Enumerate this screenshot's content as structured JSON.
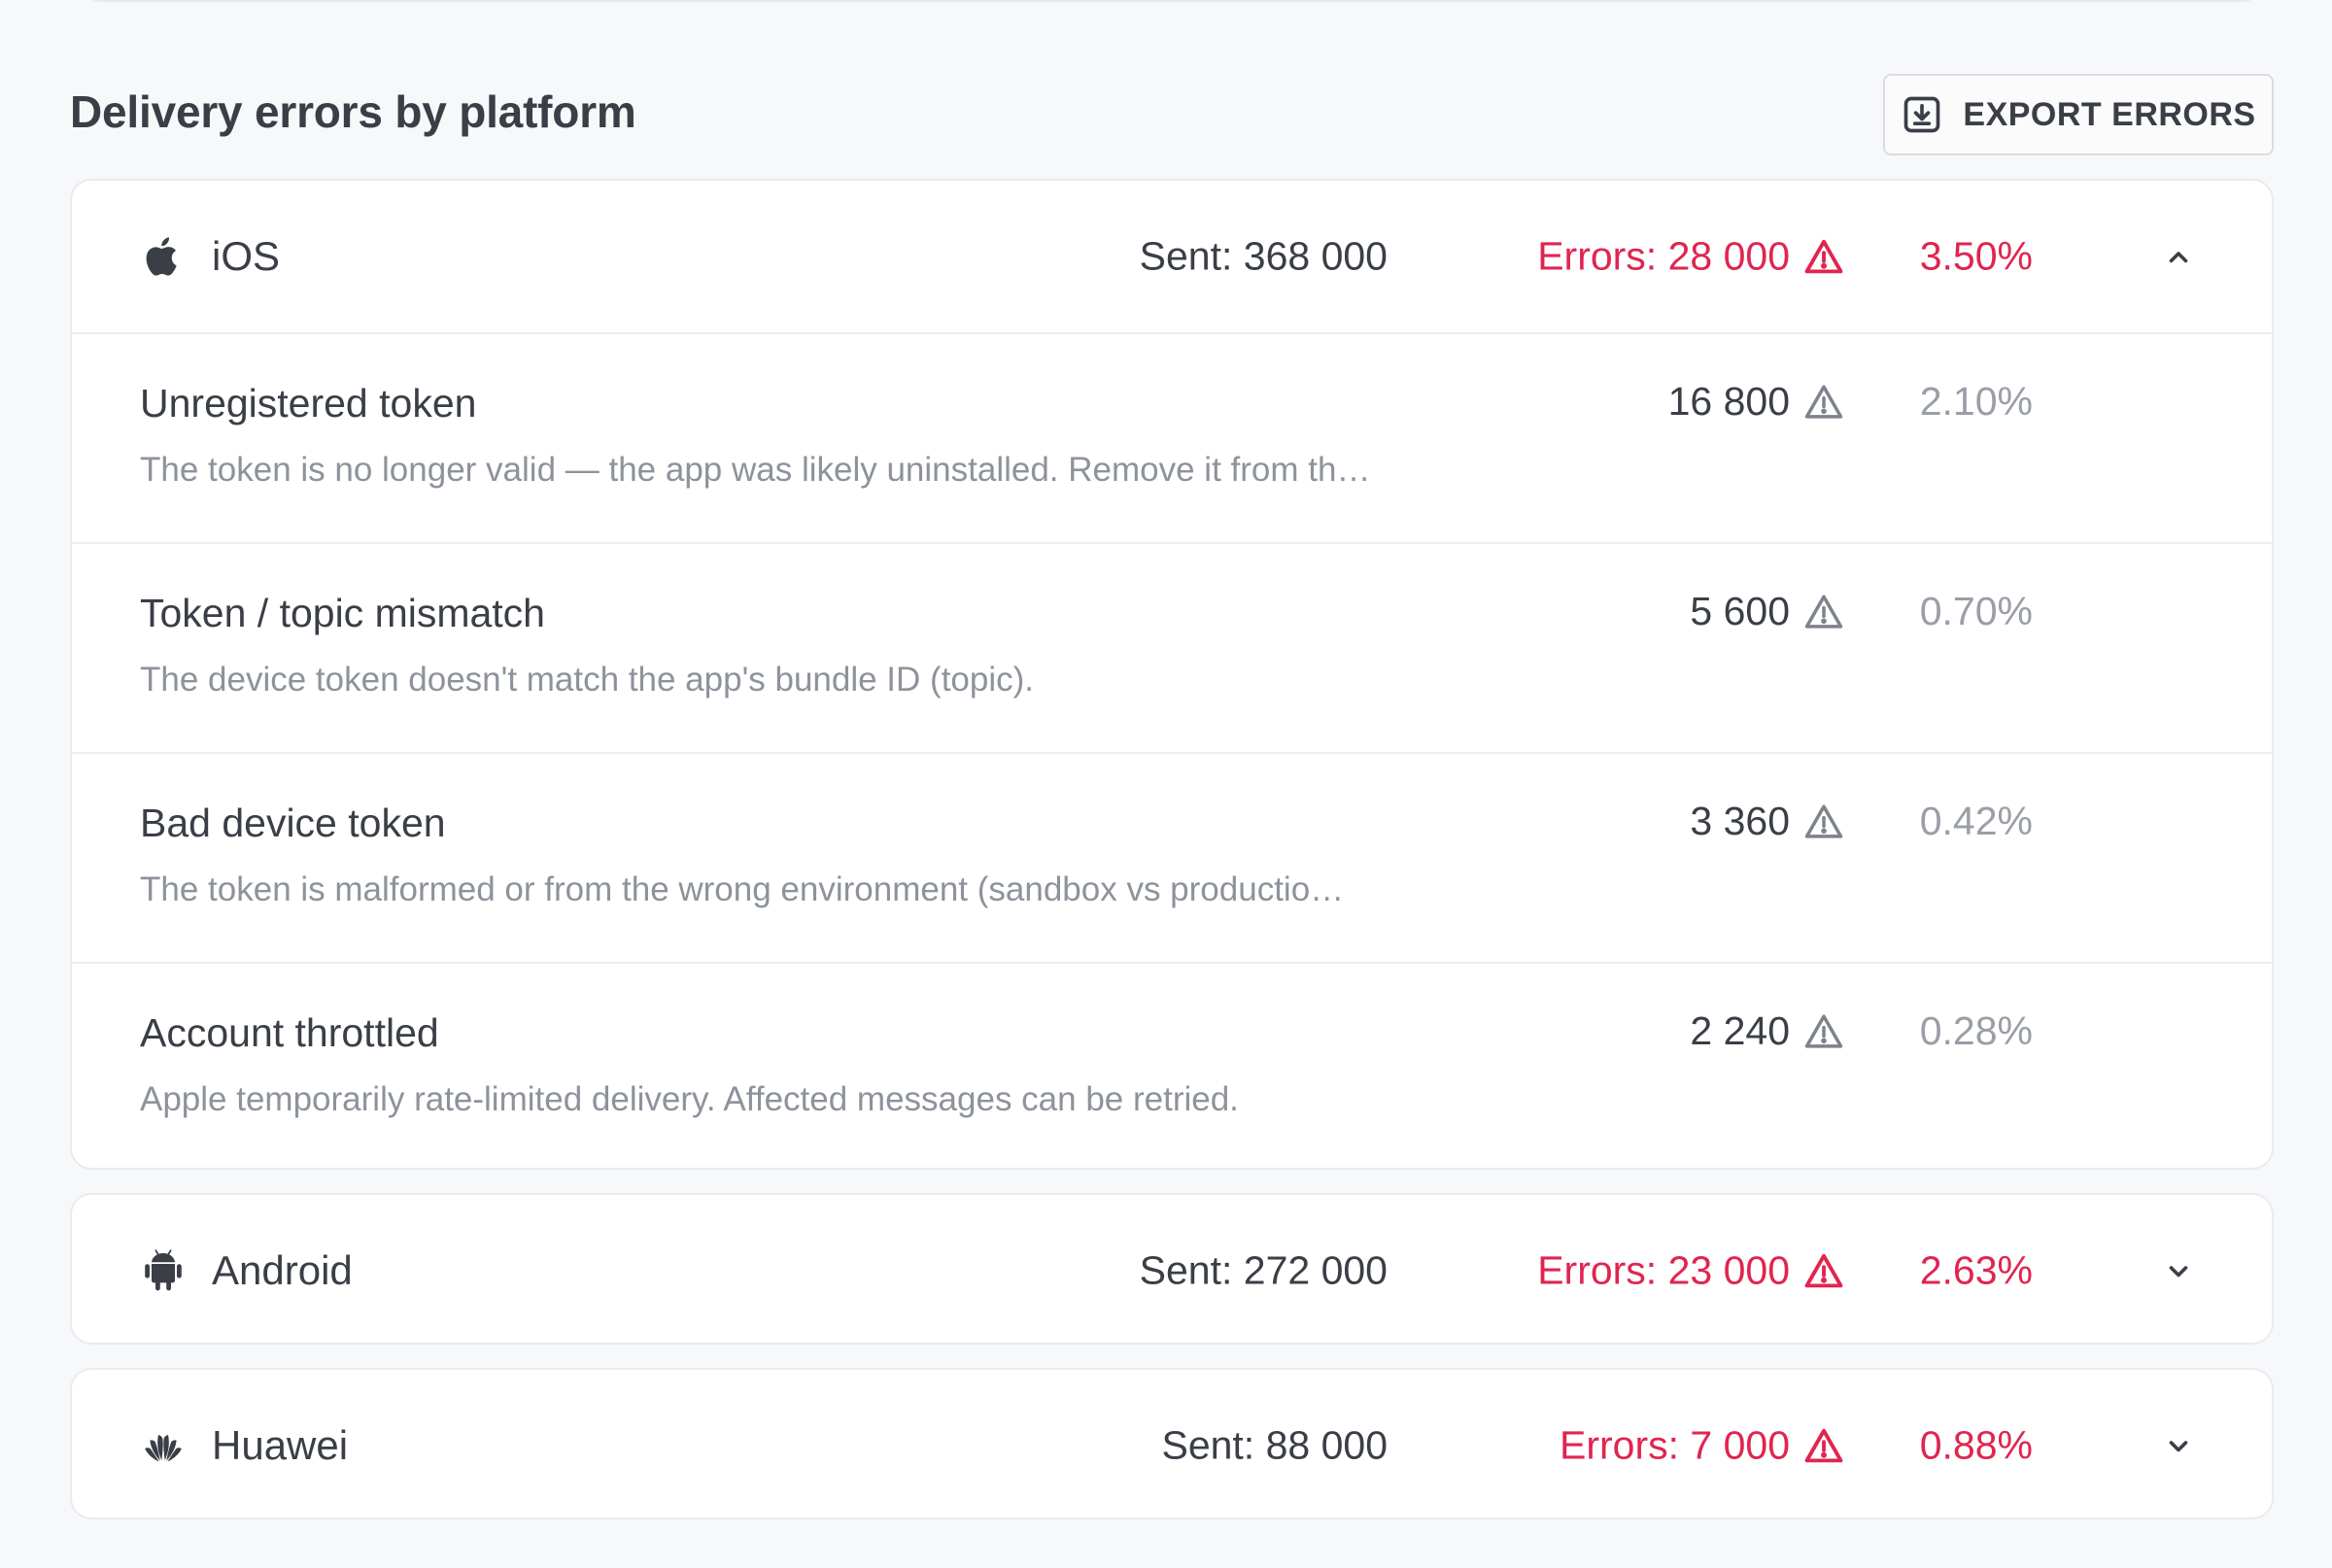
{
  "section": {
    "title": "Delivery errors by platform",
    "export_label": "EXPORT ERRORS"
  },
  "colors": {
    "error": "#e0254f",
    "text": "#3a3e46",
    "muted": "#8d929b"
  },
  "platforms": [
    {
      "name": "iOS",
      "icon": "apple-icon",
      "sent": "Sent: 368 000",
      "errors": "Errors: 28 000",
      "rate": "3.50%",
      "expanded": true,
      "error_types": [
        {
          "title": "Unregistered token",
          "description": "The token is no longer valid — the app was likely uninstalled. Remove it from th…",
          "count": "16 800",
          "pct": "2.10%"
        },
        {
          "title": "Token / topic mismatch",
          "description": "The device token doesn't match the app's bundle ID (topic).",
          "count": "5 600",
          "pct": "0.70%"
        },
        {
          "title": "Bad device token",
          "description": "The token is malformed or from the wrong environment (sandbox vs productio…",
          "count": "3 360",
          "pct": "0.42%"
        },
        {
          "title": "Account throttled",
          "description": "Apple temporarily rate-limited delivery. Affected messages can be retried.",
          "count": "2 240",
          "pct": "0.28%"
        }
      ]
    },
    {
      "name": "Android",
      "icon": "android-icon",
      "sent": "Sent: 272 000",
      "errors": "Errors: 23 000",
      "rate": "2.63%",
      "expanded": false
    },
    {
      "name": "Huawei",
      "icon": "huawei-icon",
      "sent": "Sent: 88 000",
      "errors": "Errors: 7 000",
      "rate": "0.88%",
      "expanded": false
    }
  ]
}
